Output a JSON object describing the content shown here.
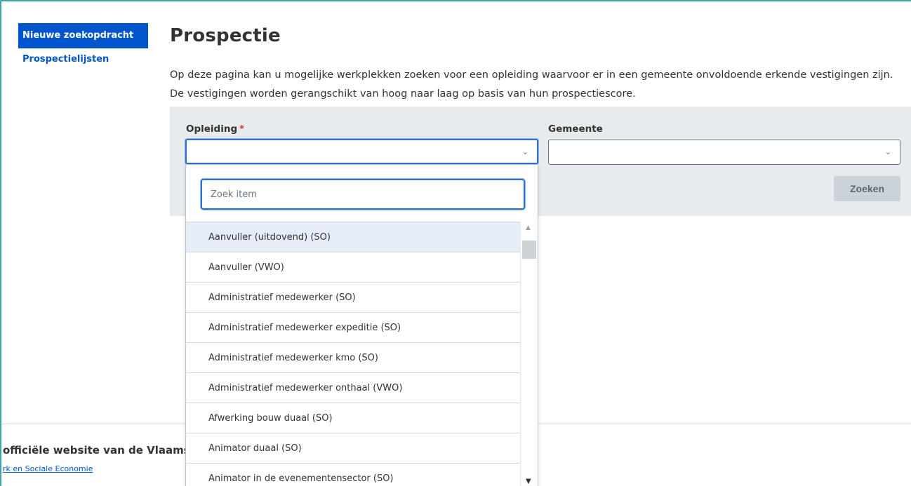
{
  "sidebar": {
    "items": [
      {
        "label": "Nieuwe zoekopdracht",
        "active": true
      },
      {
        "label": "Prospectielijsten",
        "active": false
      }
    ]
  },
  "main": {
    "title": "Prospectie",
    "intro": "Op deze pagina kan u mogelijke werkplekken zoeken voor een opleiding waarvoor er in een gemeente onvoldoende erkende vestigingen zijn. De vestigingen worden gerangschikt van hoog naar laag op basis van hun prospectiescore."
  },
  "filters": {
    "opleiding_label": "Opleiding",
    "required_mark": "*",
    "opleiding_value": "",
    "gemeente_label": "Gemeente",
    "gemeente_value": "",
    "search_button": "Zoeken"
  },
  "dropdown": {
    "search_placeholder": "Zoek item",
    "options": [
      "Aanvuller (uitdovend) (SO)",
      "Aanvuller (VWO)",
      "Administratief medewerker (SO)",
      "Administratief medewerker expeditie (SO)",
      "Administratief medewerker kmo (SO)",
      "Administratief medewerker onthaal (VWO)",
      "Afwerking bouw duaal (SO)",
      "Animator duaal (SO)",
      "Animator in de evenementensector (SO)"
    ],
    "highlighted_index": 0
  },
  "footer": {
    "title": "officiële website van de Vlaams",
    "link": "rk en Sociale Economie"
  },
  "colors": {
    "accent": "#0055cc",
    "frame": "#3aa5a9",
    "required": "#d2373c",
    "focus": "#2e6fcf"
  },
  "icons": {
    "select_arrow": "chevron-down-icon",
    "scroll_up": "arrow-up-icon",
    "scroll_down": "arrow-down-icon"
  }
}
